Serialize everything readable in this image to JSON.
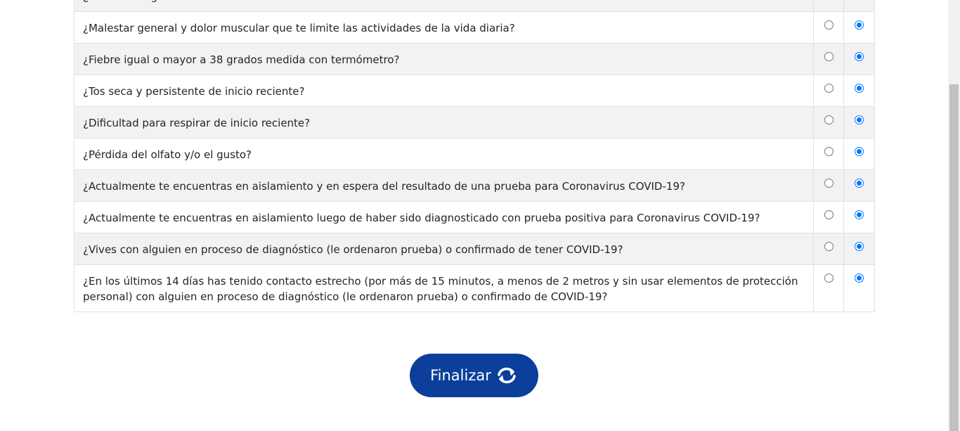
{
  "questions": [
    {
      "text": "¿Pérdida del gusto o el olfato?",
      "yes": false,
      "no": true
    },
    {
      "text": "¿Malestar general y dolor muscular que te limite las actividades de la vida diaria?",
      "yes": false,
      "no": true
    },
    {
      "text": "¿Fiebre igual o mayor a 38 grados medida con termómetro?",
      "yes": false,
      "no": true
    },
    {
      "text": "¿Tos seca y persistente de inicio reciente?",
      "yes": false,
      "no": true
    },
    {
      "text": "¿Dificultad para respirar de inicio reciente?",
      "yes": false,
      "no": true
    },
    {
      "text": "¿Pérdida del olfato y/o el gusto?",
      "yes": false,
      "no": true
    },
    {
      "text": "¿Actualmente te encuentras en aislamiento y en espera del resultado de una prueba para Coronavirus COVID-19?",
      "yes": false,
      "no": true
    },
    {
      "text": "¿Actualmente te encuentras en aislamiento luego de haber sido diagnosticado con prueba positiva para Coronavirus COVID-19?",
      "yes": false,
      "no": true
    },
    {
      "text": "¿Vives con alguien en proceso de diagnóstico (le ordenaron prueba) o confirmado de tener COVID-19?",
      "yes": false,
      "no": true
    },
    {
      "text": "¿En los últimos 14 días has tenido contacto estrecho (por más de 15 minutos, a menos de 2 metros y sin usar elementos de protección personal) con alguien en proceso de diagnóstico (le ordenaron prueba) o confirmado de COVID-19?",
      "yes": false,
      "no": true
    }
  ],
  "finalize": {
    "label": "Finalizar",
    "icon": "refresh-icon"
  },
  "colors": {
    "button_bg": "#0b3f9b",
    "radio_selected": "#0075ff",
    "row_alt": "#f2f2f2"
  }
}
